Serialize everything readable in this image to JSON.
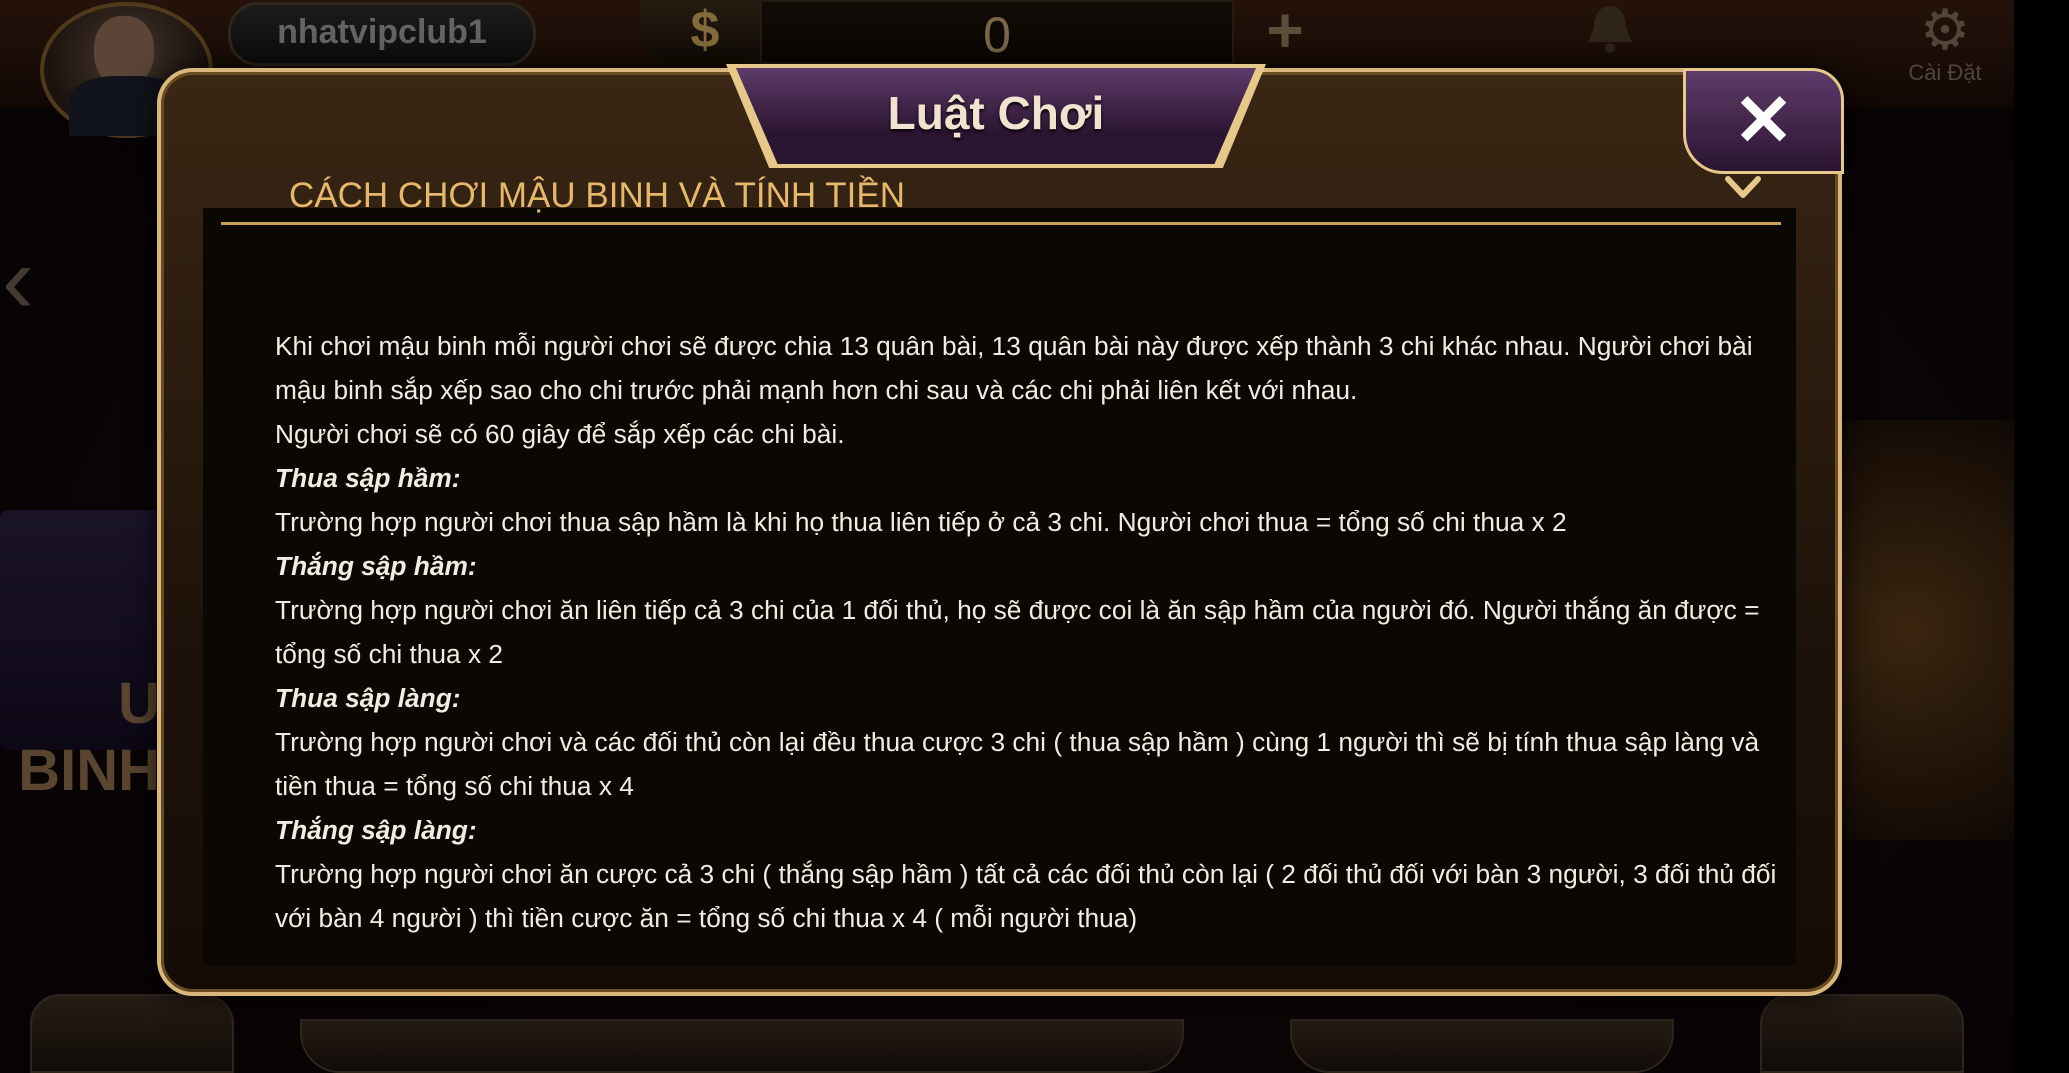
{
  "topbar": {
    "username": "nhatvipclub1",
    "currency_symbol": "$",
    "balance": "0",
    "add_symbol": "+",
    "settings_label": "Cài Đặt"
  },
  "background": {
    "left_card_title": "U BINH"
  },
  "dialog": {
    "title": "Luật Chơi",
    "close_symbol": "✕",
    "section_title": "CÁCH CHƠI MẬU BINH VÀ TÍNH TIỀN",
    "chevron_symbol": "⌄",
    "paragraphs": [
      {
        "type": "text",
        "text": "Khi chơi mậu binh mỗi người chơi sẽ được chia 13 quân bài, 13 quân bài này được xếp thành 3 chi khác nhau. Người chơi bài mậu binh sắp xếp sao cho chi trước phải mạnh hơn chi sau và các chi phải liên kết với nhau."
      },
      {
        "type": "text",
        "text": "Người chơi sẽ có 60 giây để sắp xếp các chi bài."
      },
      {
        "type": "heading",
        "text": "Thua sập hầm:"
      },
      {
        "type": "text",
        "text": "Trường hợp người chơi thua sập hầm là khi họ thua liên tiếp ở cả 3 chi. Người chơi thua = tổng số chi thua x 2"
      },
      {
        "type": "heading",
        "text": "Thắng sập hầm:"
      },
      {
        "type": "text",
        "text": "Trường hợp người chơi ăn liên tiếp cả 3 chi của 1 đối thủ, họ sẽ được coi là ăn sập hầm của người đó. Người thắng ăn được = tổng số chi thua x 2"
      },
      {
        "type": "heading",
        "text": "Thua sập làng:"
      },
      {
        "type": "text",
        "text": "Trường hợp người chơi và các đối thủ còn lại đều thua cược 3 chi ( thua sập hầm ) cùng 1 người thì sẽ bị tính thua sập làng và tiền thua = tổng số chi thua x 4"
      },
      {
        "type": "heading",
        "text": "Thắng sập làng:"
      },
      {
        "type": "text",
        "text": "Trường hợp người chơi ăn cược cả 3 chi ( thắng sập hầm ) tất cả các đối thủ còn lại ( 2 đối thủ đối với bàn 3 người, 3 đối thủ đối với bàn 4 người ) thì tiền cược ăn = tổng số chi thua x 4 ( mỗi người thua)"
      }
    ]
  }
}
